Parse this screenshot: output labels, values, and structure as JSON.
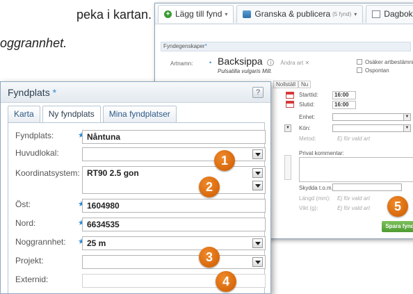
{
  "intro": {
    "line1": "peka i kartan.",
    "line2": "oggrannhet."
  },
  "back_window": {
    "tabs": [
      {
        "label": "Lägg till fynd",
        "icon": "plus-circle-icon"
      },
      {
        "label": "Granska & publicera",
        "count": "(5 fynd)",
        "icon": "review-icon"
      },
      {
        "label": "Dagboksblad",
        "icon": "edit-icon"
      }
    ],
    "section_title": "Fyndegenskaper",
    "art_label": "Artnamn:",
    "species": "Backsippa",
    "change_species": "Ändra art ✕",
    "latin": "Pulsatilla vulgaris Mill.",
    "checkbox_uncertain": "Osäker artbestämning",
    "checkbox_spontaneous": "Ospontan",
    "time_header": [
      "Nollställ",
      "Nu"
    ],
    "start_label": "Starttid:",
    "start_value": "16:00",
    "end_label": "Slutid:",
    "end_value": "16:00",
    "unit_label": "Enhet:",
    "gender_label": "Kön:",
    "method_label": "Metod:",
    "method_hint": "Ej för vald art",
    "private_comment_label": "Privat kommentar:",
    "protected_label": "Skydda t.o.m.:",
    "length_label": "Längd (mm):",
    "length_hint": "Ej för vald art",
    "weight_label": "Vikt (g):",
    "weight_hint": "Ej för vald art",
    "save_label": "Spara fynd"
  },
  "front_panel": {
    "title": "Fyndplats",
    "help_label": "?",
    "tabs": [
      "Karta",
      "Ny fyndplats",
      "Mina fyndplatser"
    ],
    "fields": {
      "fyndplats": {
        "label": "Fyndplats:",
        "value": "Nåntuna"
      },
      "huvudlokal": {
        "label": "Huvudlokal:",
        "value": ""
      },
      "koordinatsystem": {
        "label": "Koordinatsystem:",
        "value": "RT90 2.5 gon"
      },
      "ost": {
        "label": "Öst:",
        "value": "1604980"
      },
      "nord": {
        "label": "Nord:",
        "value": "6634535"
      },
      "noggrannhet": {
        "label": "Noggrannhet:",
        "value": "25 m"
      },
      "projekt": {
        "label": "Projekt:",
        "value": ""
      },
      "externid": {
        "label": "Externid:",
        "value": ""
      }
    }
  },
  "badges": [
    "1",
    "2",
    "3",
    "4",
    "5"
  ],
  "colors": {
    "badge": "#e06f10",
    "accent": "#2a8ad4",
    "save": "#5aa83b"
  }
}
